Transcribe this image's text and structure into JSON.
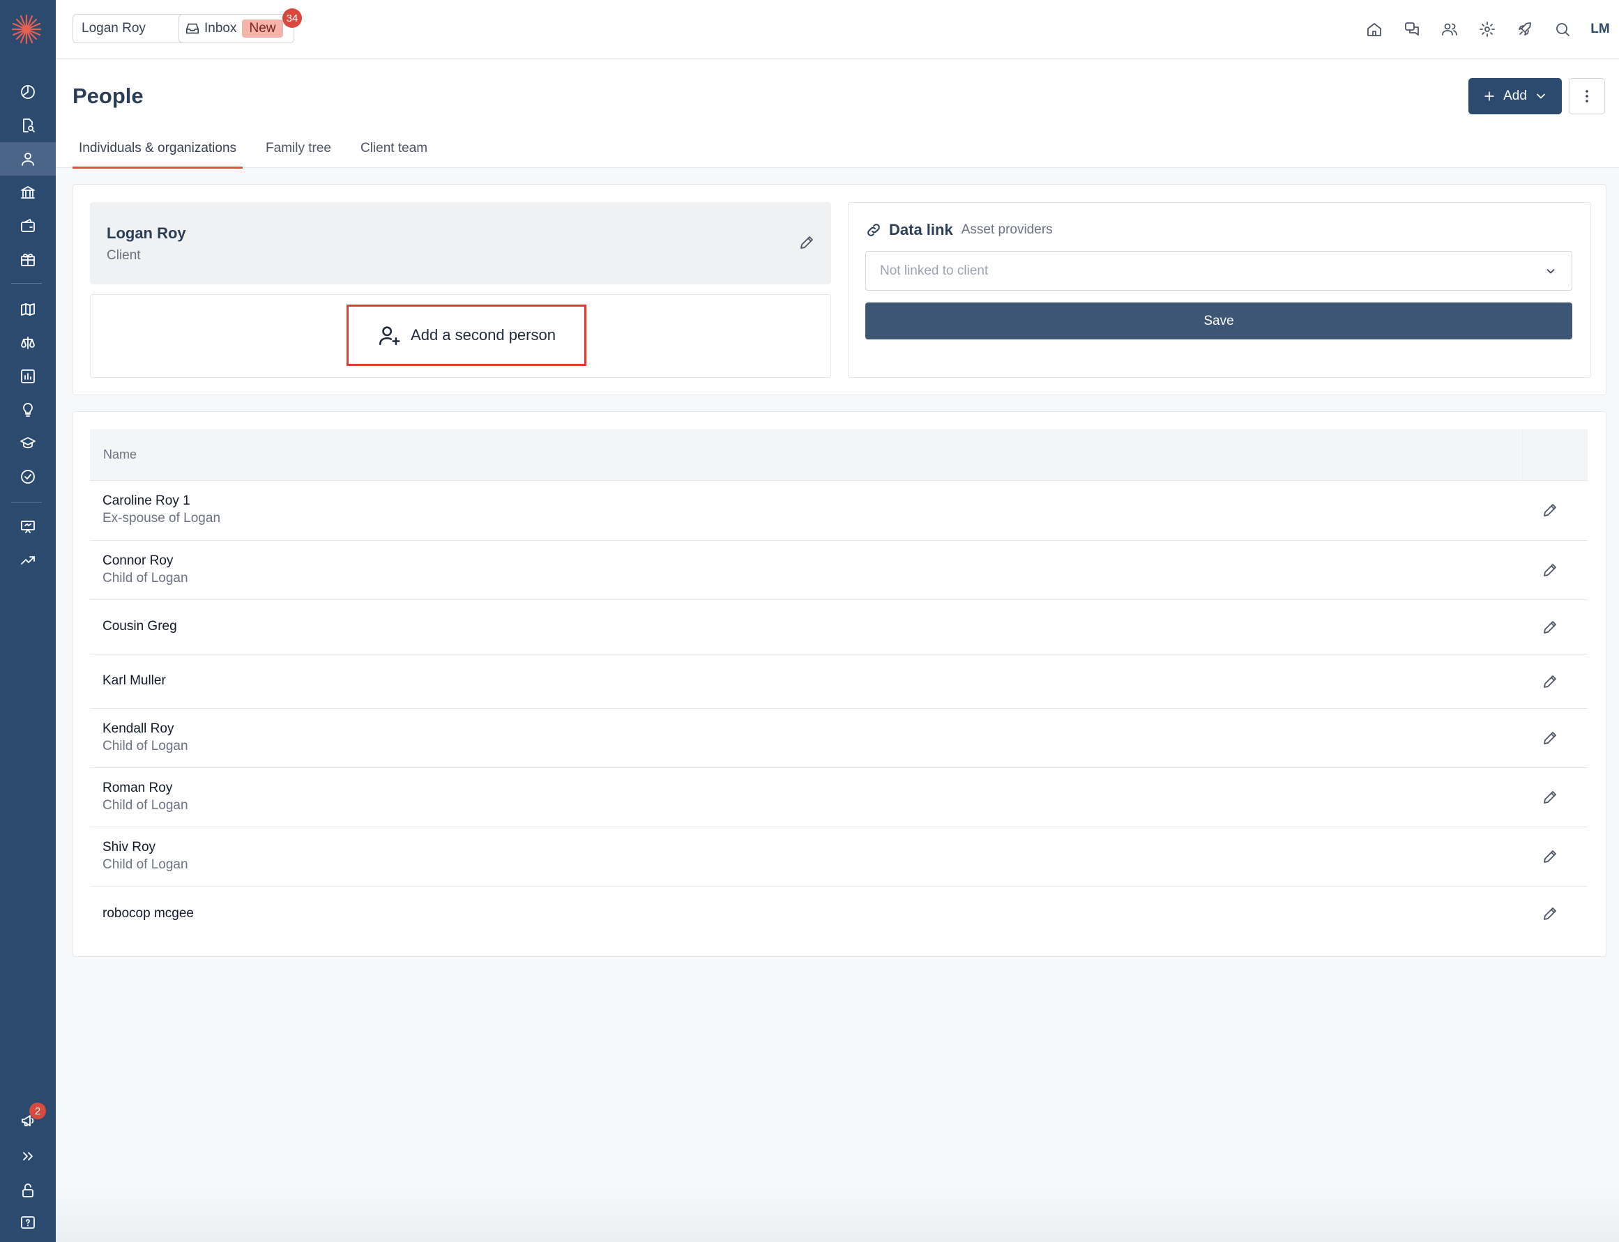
{
  "topbar": {
    "client_label": "Logan Roy",
    "inbox_label": "Inbox",
    "inbox_new": "New",
    "inbox_count": "34",
    "avatar_initials": "LM"
  },
  "sidebar": {
    "announcement_badge": "2"
  },
  "page": {
    "title": "People",
    "add_label": "Add",
    "tabs": [
      "Individuals & organizations",
      "Family tree",
      "Client team"
    ]
  },
  "client": {
    "name": "Logan Roy",
    "role": "Client",
    "add_second_label": "Add a second person"
  },
  "data_link": {
    "title": "Data link",
    "subtitle": "Asset providers",
    "select_placeholder": "Not linked to client",
    "save_label": "Save"
  },
  "table": {
    "header_name": "Name",
    "rows": [
      {
        "name": "Caroline Roy 1",
        "relation": "Ex-spouse of Logan"
      },
      {
        "name": "Connor Roy",
        "relation": "Child of Logan"
      },
      {
        "name": "Cousin Greg",
        "relation": ""
      },
      {
        "name": "Karl Muller",
        "relation": ""
      },
      {
        "name": "Kendall Roy",
        "relation": "Child of Logan"
      },
      {
        "name": "Roman Roy",
        "relation": "Child of Logan"
      },
      {
        "name": "Shiv Roy",
        "relation": "Child of Logan"
      },
      {
        "name": "robocop mcgee",
        "relation": ""
      }
    ]
  },
  "colors": {
    "sidebar": "#2b4a6e",
    "accent": "#e1503f",
    "primary_button": "#2b4a6e",
    "highlight_border": "#e03c2c"
  }
}
